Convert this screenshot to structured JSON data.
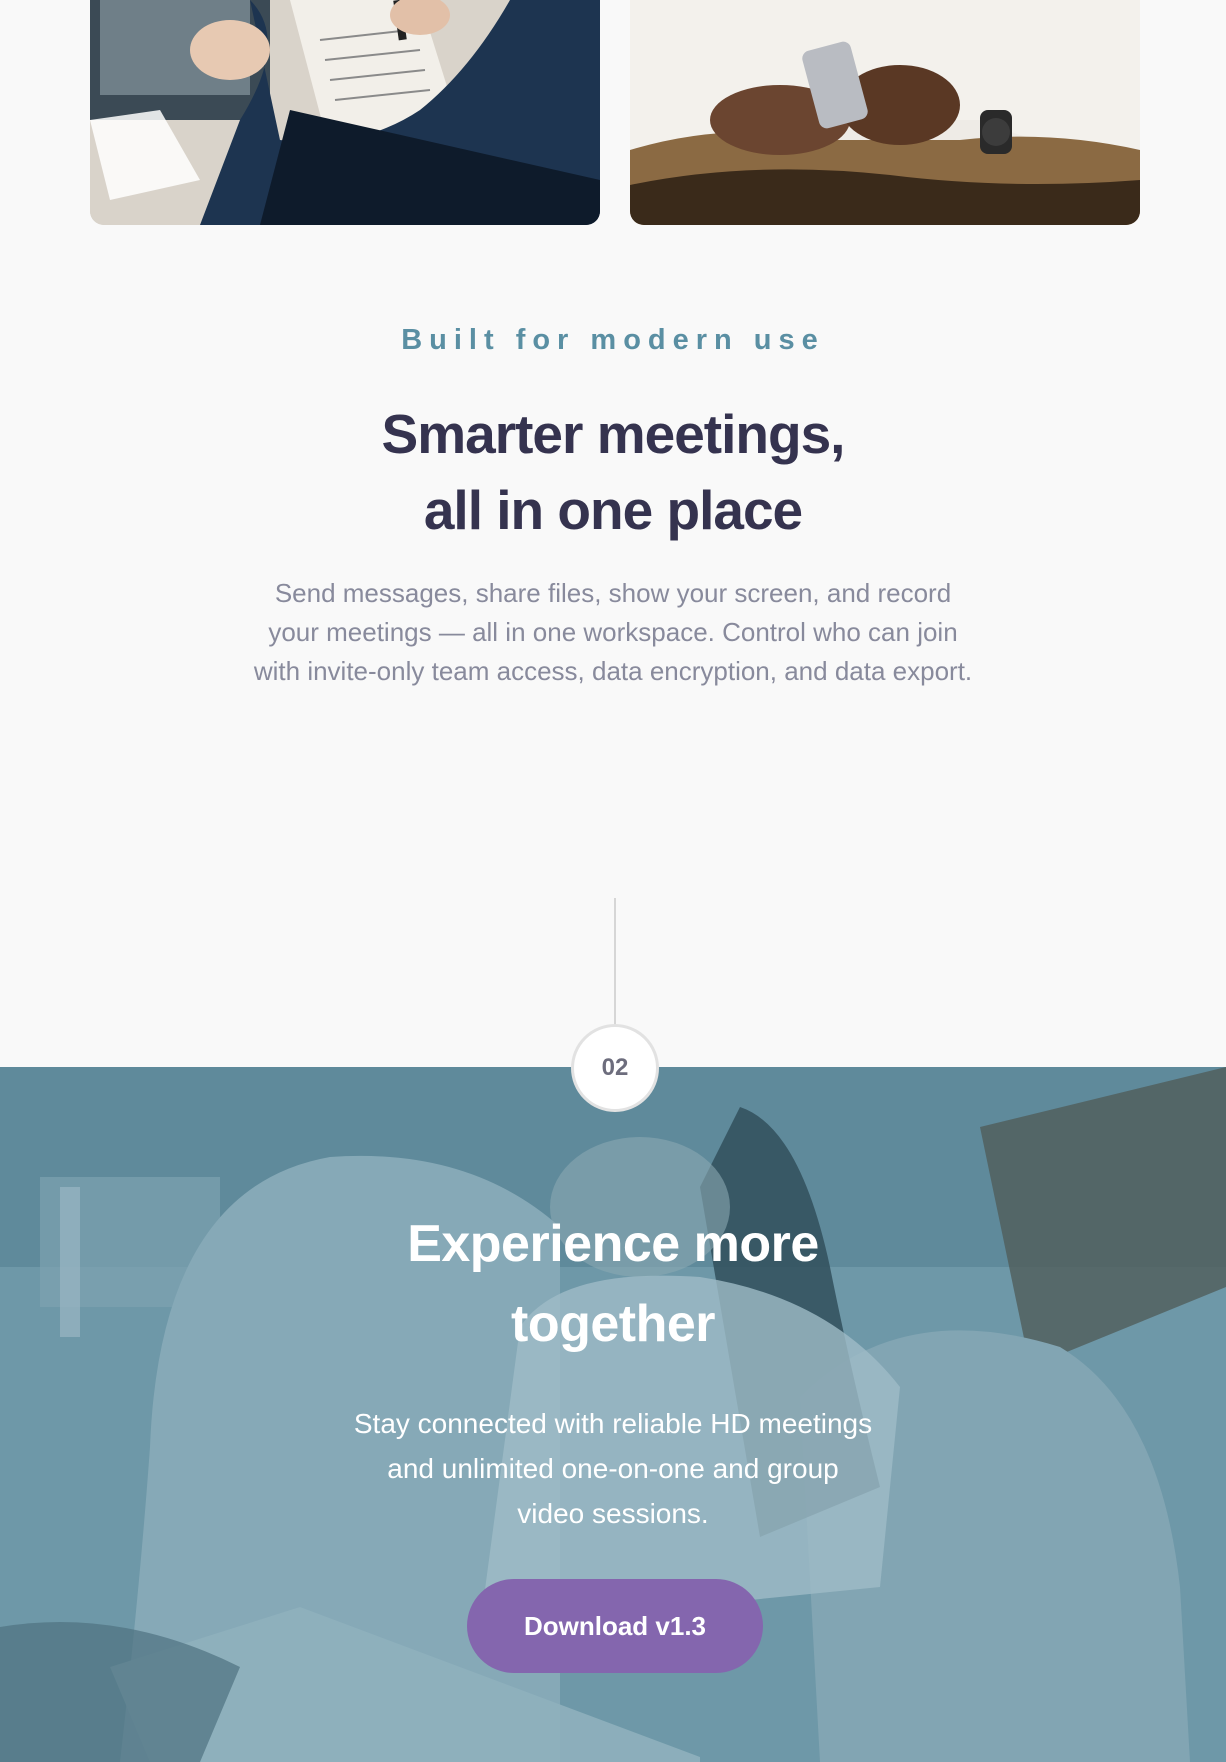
{
  "gallery": {
    "images": [
      {
        "name": "person-reviewing-documents-photo"
      },
      {
        "name": "person-holding-smartphone-photo"
      }
    ]
  },
  "features": {
    "eyebrow": "Built for modern use",
    "headline_line1": "Smarter meetings,",
    "headline_line2": "all in one place",
    "description": "Send messages, share files, show your screen, and record your meetings — all in one workspace. Control who can join with invite-only team access, data encryption, and data export."
  },
  "step": {
    "number": "02"
  },
  "hero": {
    "title_line1": "Experience more",
    "title_line2": "together",
    "description": "Stay connected with reliable HD meetings and unlimited one-on-one and group video sessions.",
    "button_label": "Download v1.3"
  },
  "colors": {
    "accent": "#5a8fa3",
    "heading": "#35334f",
    "body_text": "#888a9c",
    "hero_overlay": "#6e98a8",
    "button": "#8466ae"
  }
}
